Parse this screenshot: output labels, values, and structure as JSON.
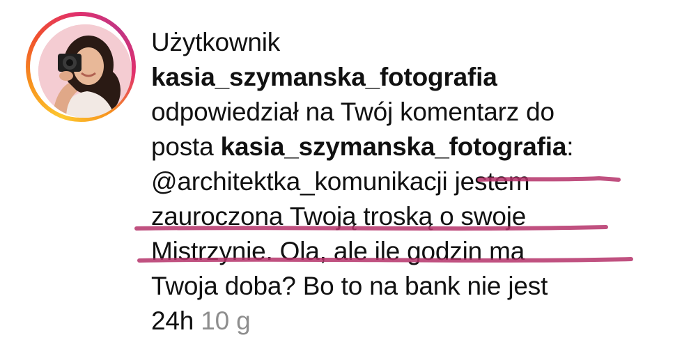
{
  "notification": {
    "prefix": "Użytkownik",
    "username": "kasia_szymanska_fotografia",
    "action_text": "odpowiedział na Twój komentarz do",
    "post_prefix": "posta",
    "post_owner": "kasia_szymanska_fotografia",
    "colon": ":",
    "comment_lines": [
      "@architektka_komunikacji jestem",
      "zauroczona Twoją troską o swoje",
      "Mistrzynie. Ola, ale ile godzin ma",
      "Twoja doba? Bo to na bank nie jest"
    ],
    "comment_last": "24h",
    "timestamp": "10 g"
  },
  "colors": {
    "ring_gradient": [
      "#fdc830",
      "#f7931e",
      "#e1306c",
      "#c13584"
    ],
    "highlight_marker": "#b5336a",
    "timestamp": "#8e8e8e"
  },
  "icons": {
    "avatar": "profile-photo"
  }
}
